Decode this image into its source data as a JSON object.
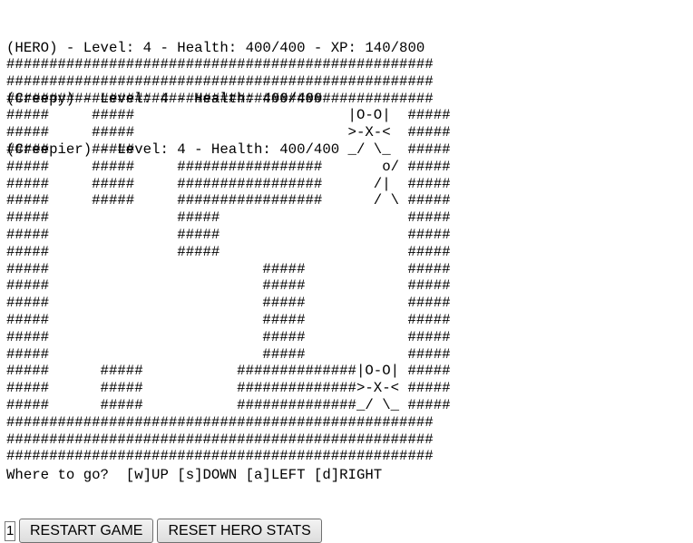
{
  "status": {
    "hero_line": "(HERO) - Level: 4 - Health: 400/400 - XP: 140/800",
    "enemies": [
      "(Creepy) - Level: 4 - Health: 400/400",
      "(Creepier) - Level: 4 - Health: 400/400"
    ]
  },
  "map": {
    "rows": [
      "##################################################",
      "##################################################",
      "##################################################",
      "#####     #####                         |O-O|  #####",
      "#####     #####                         >-X-<  #####",
      "#####     #####                         _/ \\_  #####",
      "#####     #####     #################       o/ #####",
      "#####     #####     #################      /|  #####",
      "#####     #####     #################      / \\ #####",
      "#####               #####                      #####",
      "#####               #####                      #####",
      "#####               #####                      #####",
      "#####                         #####            #####",
      "#####                         #####            #####",
      "#####                         #####            #####",
      "#####                         #####            #####",
      "#####                         #####            #####",
      "#####                         #####            #####",
      "#####      #####           ##############|O-O| #####",
      "#####      #####           ##############>-X-< #####",
      "#####      #####           ##############_/ \\_ #####",
      "##################################################",
      "##################################################",
      "##################################################"
    ]
  },
  "prompt": "Where to go?  [w]UP [s]DOWN [a]LEFT [d]RIGHT",
  "controls": {
    "input_value": "1",
    "restart_label": "RESTART GAME",
    "reset_label": "RESET HERO STATS"
  }
}
